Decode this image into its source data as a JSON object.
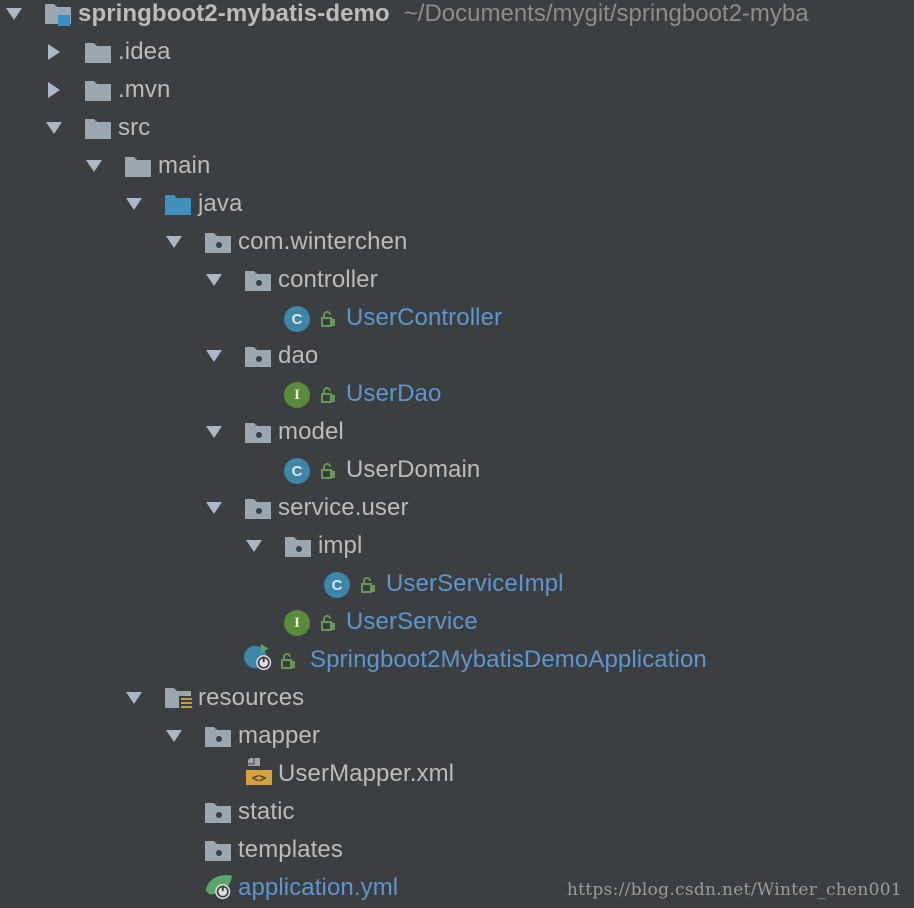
{
  "project": {
    "name": "springboot2-mybatis-demo",
    "path": "~/Documents/mygit/springboot2-myba"
  },
  "tree": [
    {
      "label": "springboot2-mybatis-demo",
      "depth": 0,
      "arrow": "down",
      "icon": "project-folder-icon"
    },
    {
      "label": ".idea",
      "depth": 1,
      "arrow": "right",
      "icon": "folder-icon"
    },
    {
      "label": ".mvn",
      "depth": 1,
      "arrow": "right",
      "icon": "folder-icon"
    },
    {
      "label": "src",
      "depth": 1,
      "arrow": "down",
      "icon": "folder-icon"
    },
    {
      "label": "main",
      "depth": 2,
      "arrow": "down",
      "icon": "folder-icon"
    },
    {
      "label": "java",
      "depth": 3,
      "arrow": "down",
      "icon": "source-folder-icon"
    },
    {
      "label": "com.winterchen",
      "depth": 4,
      "arrow": "down",
      "icon": "package-icon"
    },
    {
      "label": "controller",
      "depth": 5,
      "arrow": "down",
      "icon": "package-icon"
    },
    {
      "label": "UserController",
      "depth": 6,
      "arrow": "none",
      "icon": "class-icon"
    },
    {
      "label": "dao",
      "depth": 5,
      "arrow": "down",
      "icon": "package-icon"
    },
    {
      "label": "UserDao",
      "depth": 6,
      "arrow": "none",
      "icon": "interface-icon"
    },
    {
      "label": "model",
      "depth": 5,
      "arrow": "down",
      "icon": "package-icon"
    },
    {
      "label": "UserDomain",
      "depth": 6,
      "arrow": "none",
      "icon": "class-icon"
    },
    {
      "label": "service.user",
      "depth": 5,
      "arrow": "down",
      "icon": "package-icon"
    },
    {
      "label": "impl",
      "depth": 6,
      "arrow": "down",
      "icon": "package-icon"
    },
    {
      "label": "UserServiceImpl",
      "depth": 7,
      "arrow": "none",
      "icon": "class-icon"
    },
    {
      "label": "UserService",
      "depth": 6,
      "arrow": "none",
      "icon": "interface-icon"
    },
    {
      "label": "Springboot2MybatisDemoApplication",
      "depth": 5,
      "arrow": "none",
      "icon": "spring-boot-class-icon"
    },
    {
      "label": "resources",
      "depth": 3,
      "arrow": "down",
      "icon": "resources-folder-icon"
    },
    {
      "label": "mapper",
      "depth": 4,
      "arrow": "down",
      "icon": "package-icon"
    },
    {
      "label": "UserMapper.xml",
      "depth": 5,
      "arrow": "none",
      "icon": "xml-file-icon"
    },
    {
      "label": "static",
      "depth": 4,
      "arrow": "none",
      "icon": "package-icon"
    },
    {
      "label": "templates",
      "depth": 4,
      "arrow": "none",
      "icon": "package-icon"
    },
    {
      "label": "application.yml",
      "depth": 4,
      "arrow": "none",
      "icon": "spring-yml-icon"
    }
  ],
  "watermark": "https://blog.csdn.net/Winter_chen001",
  "colors": {
    "background": "#3c3f41",
    "text": "#bbbbbb",
    "vcs_modified": "#5d95cc",
    "class_badge": "#3c87a8",
    "interface_badge": "#5a8a3a",
    "lock_green": "#629755",
    "folder_gray": "#9aa7b0",
    "source_folder": "#3f8fbf"
  }
}
